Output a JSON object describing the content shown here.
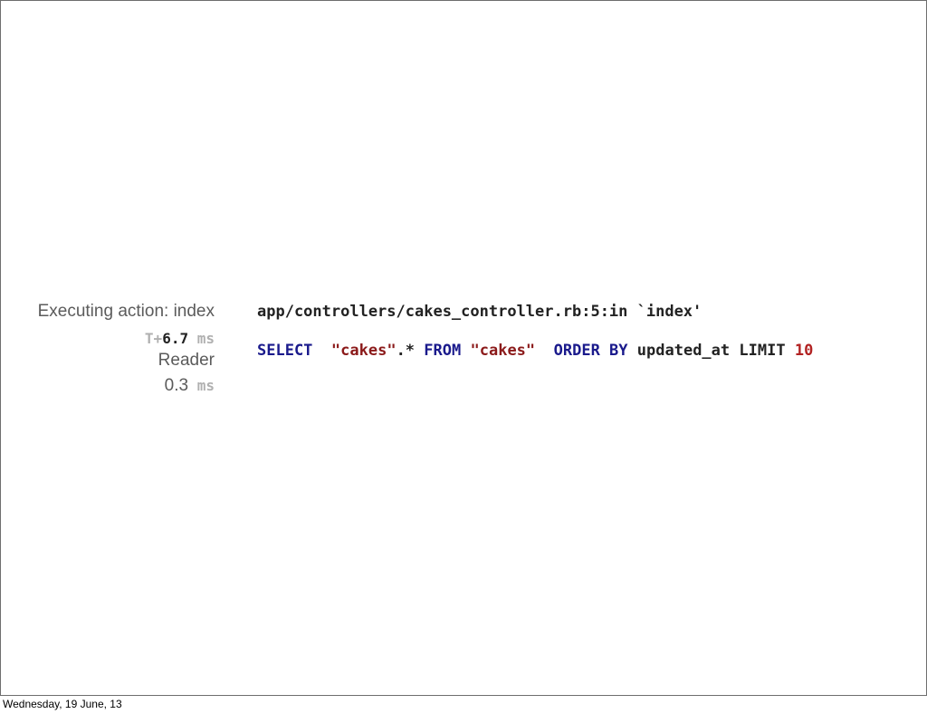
{
  "left": {
    "action_label": "Executing action: index",
    "time_prefix": "T+",
    "time_value": "6.7",
    "time_unit": "ms",
    "role": "Reader",
    "duration_value": "0.3",
    "duration_unit": "ms"
  },
  "code": {
    "trace": "app/controllers/cakes_controller.rb:5:in `index'",
    "sql": {
      "select": "SELECT",
      "table_star": "\"cakes\"",
      "dot_star": ".*",
      "from": "FROM",
      "table": "\"cakes\"",
      "order_by": "ORDER BY",
      "column": "updated_at",
      "limit": "LIMIT",
      "limit_value": "10"
    }
  },
  "footer": {
    "date": "Wednesday, 19 June, 13"
  },
  "colors": {
    "keyword": "#1a1a8c",
    "string": "#8b1a1a",
    "number": "#b22222",
    "label": "#5b5b5b",
    "muted": "#b0b0b0"
  }
}
